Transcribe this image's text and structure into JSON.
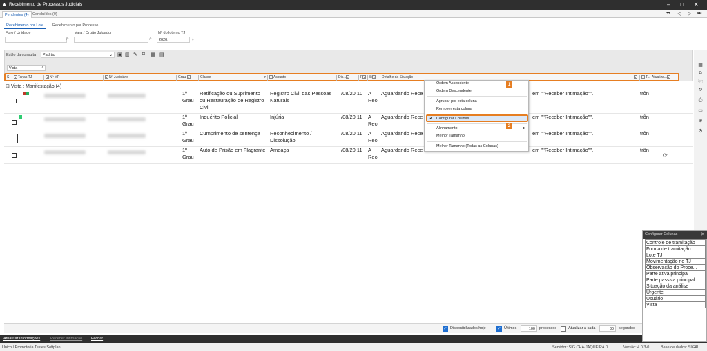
{
  "window": {
    "title": "Recebimento de Processos Judiciais",
    "controls": [
      "–",
      "□",
      "✕"
    ]
  },
  "page_tabs": [
    {
      "label": "Pendentes (4)",
      "active": true
    },
    {
      "label": "Concluídos (0)",
      "active": false
    }
  ],
  "nav_buttons": [
    "⏮",
    "◁",
    "▷",
    "⏭"
  ],
  "sub_tabs": [
    {
      "label": "Recebimento por Lote",
      "active": true
    },
    {
      "label": "Recebimento por Processo",
      "active": false
    }
  ],
  "filters": {
    "foro_label": "Foro / Unidade",
    "vara_label": "Vara / Orgão Julgador",
    "lote_label": "Nº do lote no TJ",
    "lote_value": "2020."
  },
  "consulta": {
    "label": "Estilo da consulta",
    "value": "Padrão"
  },
  "group_field": "Vista",
  "columns": [
    "S",
    "Tarjas TJ",
    "Nº MP",
    "Nº Judiciário",
    "Grau",
    "Classe",
    "Assunto",
    "Dis...",
    "F",
    "Si",
    "Detalhe da Situação",
    "T...",
    "Atualiza..."
  ],
  "group_label": "Vista : Manifestação (4)",
  "rows": [
    {
      "grau": "1º Grau",
      "classe": "Retificação ou Suprimento ou Restauração de Registro Civil",
      "assunto": "Registro Civil das Pessoas Naturais",
      "dis": "/08/20 10",
      "f": "A Rece",
      "detalhe": "Aguardando Rece",
      "detalhe_end": "em \"\"Receber Intimação\"\".",
      "t": "trôn"
    },
    {
      "grau": "1º Grau",
      "classe": "Inquérito Policial",
      "assunto": "Injúria",
      "dis": "/08/20 11",
      "f": "A Rece",
      "detalhe": "Aguardando Rece",
      "detalhe_end": "em \"\"Receber Intimação\"\".",
      "t": "trôn"
    },
    {
      "grau": "1º Grau",
      "classe": "Cumprimento de sentença",
      "assunto": "Reconhecimento / Dissolução",
      "dis": "/08/20 11",
      "f": "A Rece",
      "detalhe": "Aguardando Rece",
      "detalhe_end": "em \"\"Receber Intimação\"\".",
      "t": "trôn"
    },
    {
      "grau": "1º Grau",
      "classe": "Auto de Prisão em Flagrante",
      "assunto": "Ameaça",
      "dis": "/08/20 11",
      "f": "A Rece",
      "detalhe": "Aguardando Rece",
      "detalhe_end": "em \"\"Receber Intimação\"\".",
      "t": "trôn"
    }
  ],
  "context_menu": {
    "items": [
      "Ordem Ascendente",
      "Ordem Descendente",
      "Agrupar por esta coluna",
      "Remover esta coluna",
      "Configurar Colunas...",
      "Alinhamento",
      "Melhor Tamanho",
      "Melhor Tamanho (Todas as Colunas)"
    ],
    "badge1": "1",
    "badge2": "2"
  },
  "bottom": {
    "disponibilizados": "Disponibilizados hoje",
    "ultimos": "Últimos",
    "ultimos_value": "100",
    "processos": "processos",
    "atualizar": "Atualizar a cada",
    "atualizar_value": "30",
    "segundos": "segundos"
  },
  "actions": [
    "Atualizar Informações",
    "Receber Intimação",
    "Fechar"
  ],
  "status": {
    "left": "Unico / Promotoria Testes Softplan",
    "servidor": "Servidor: SIG.CHA-JAQUEIRA.0",
    "versao": "Versão: 4.0.3-0",
    "base": "Base de dados: SIGAL"
  },
  "config_panel": {
    "title": "Configurar Colunas",
    "items": [
      "Controle de tramitação",
      "Forma de tramitação",
      "Lote TJ",
      "Movimentação no TJ",
      "Observação do Proce...",
      "Parte ativa principal",
      "Parte passiva principal",
      "Situação da análise",
      "Urgente",
      "Usuário",
      "Vista"
    ]
  },
  "colors": {
    "accent": "#e67e22",
    "title_bg": "#2f2f2f",
    "highlight": "#dce8f7",
    "check_blue": "#1f6fd1"
  }
}
